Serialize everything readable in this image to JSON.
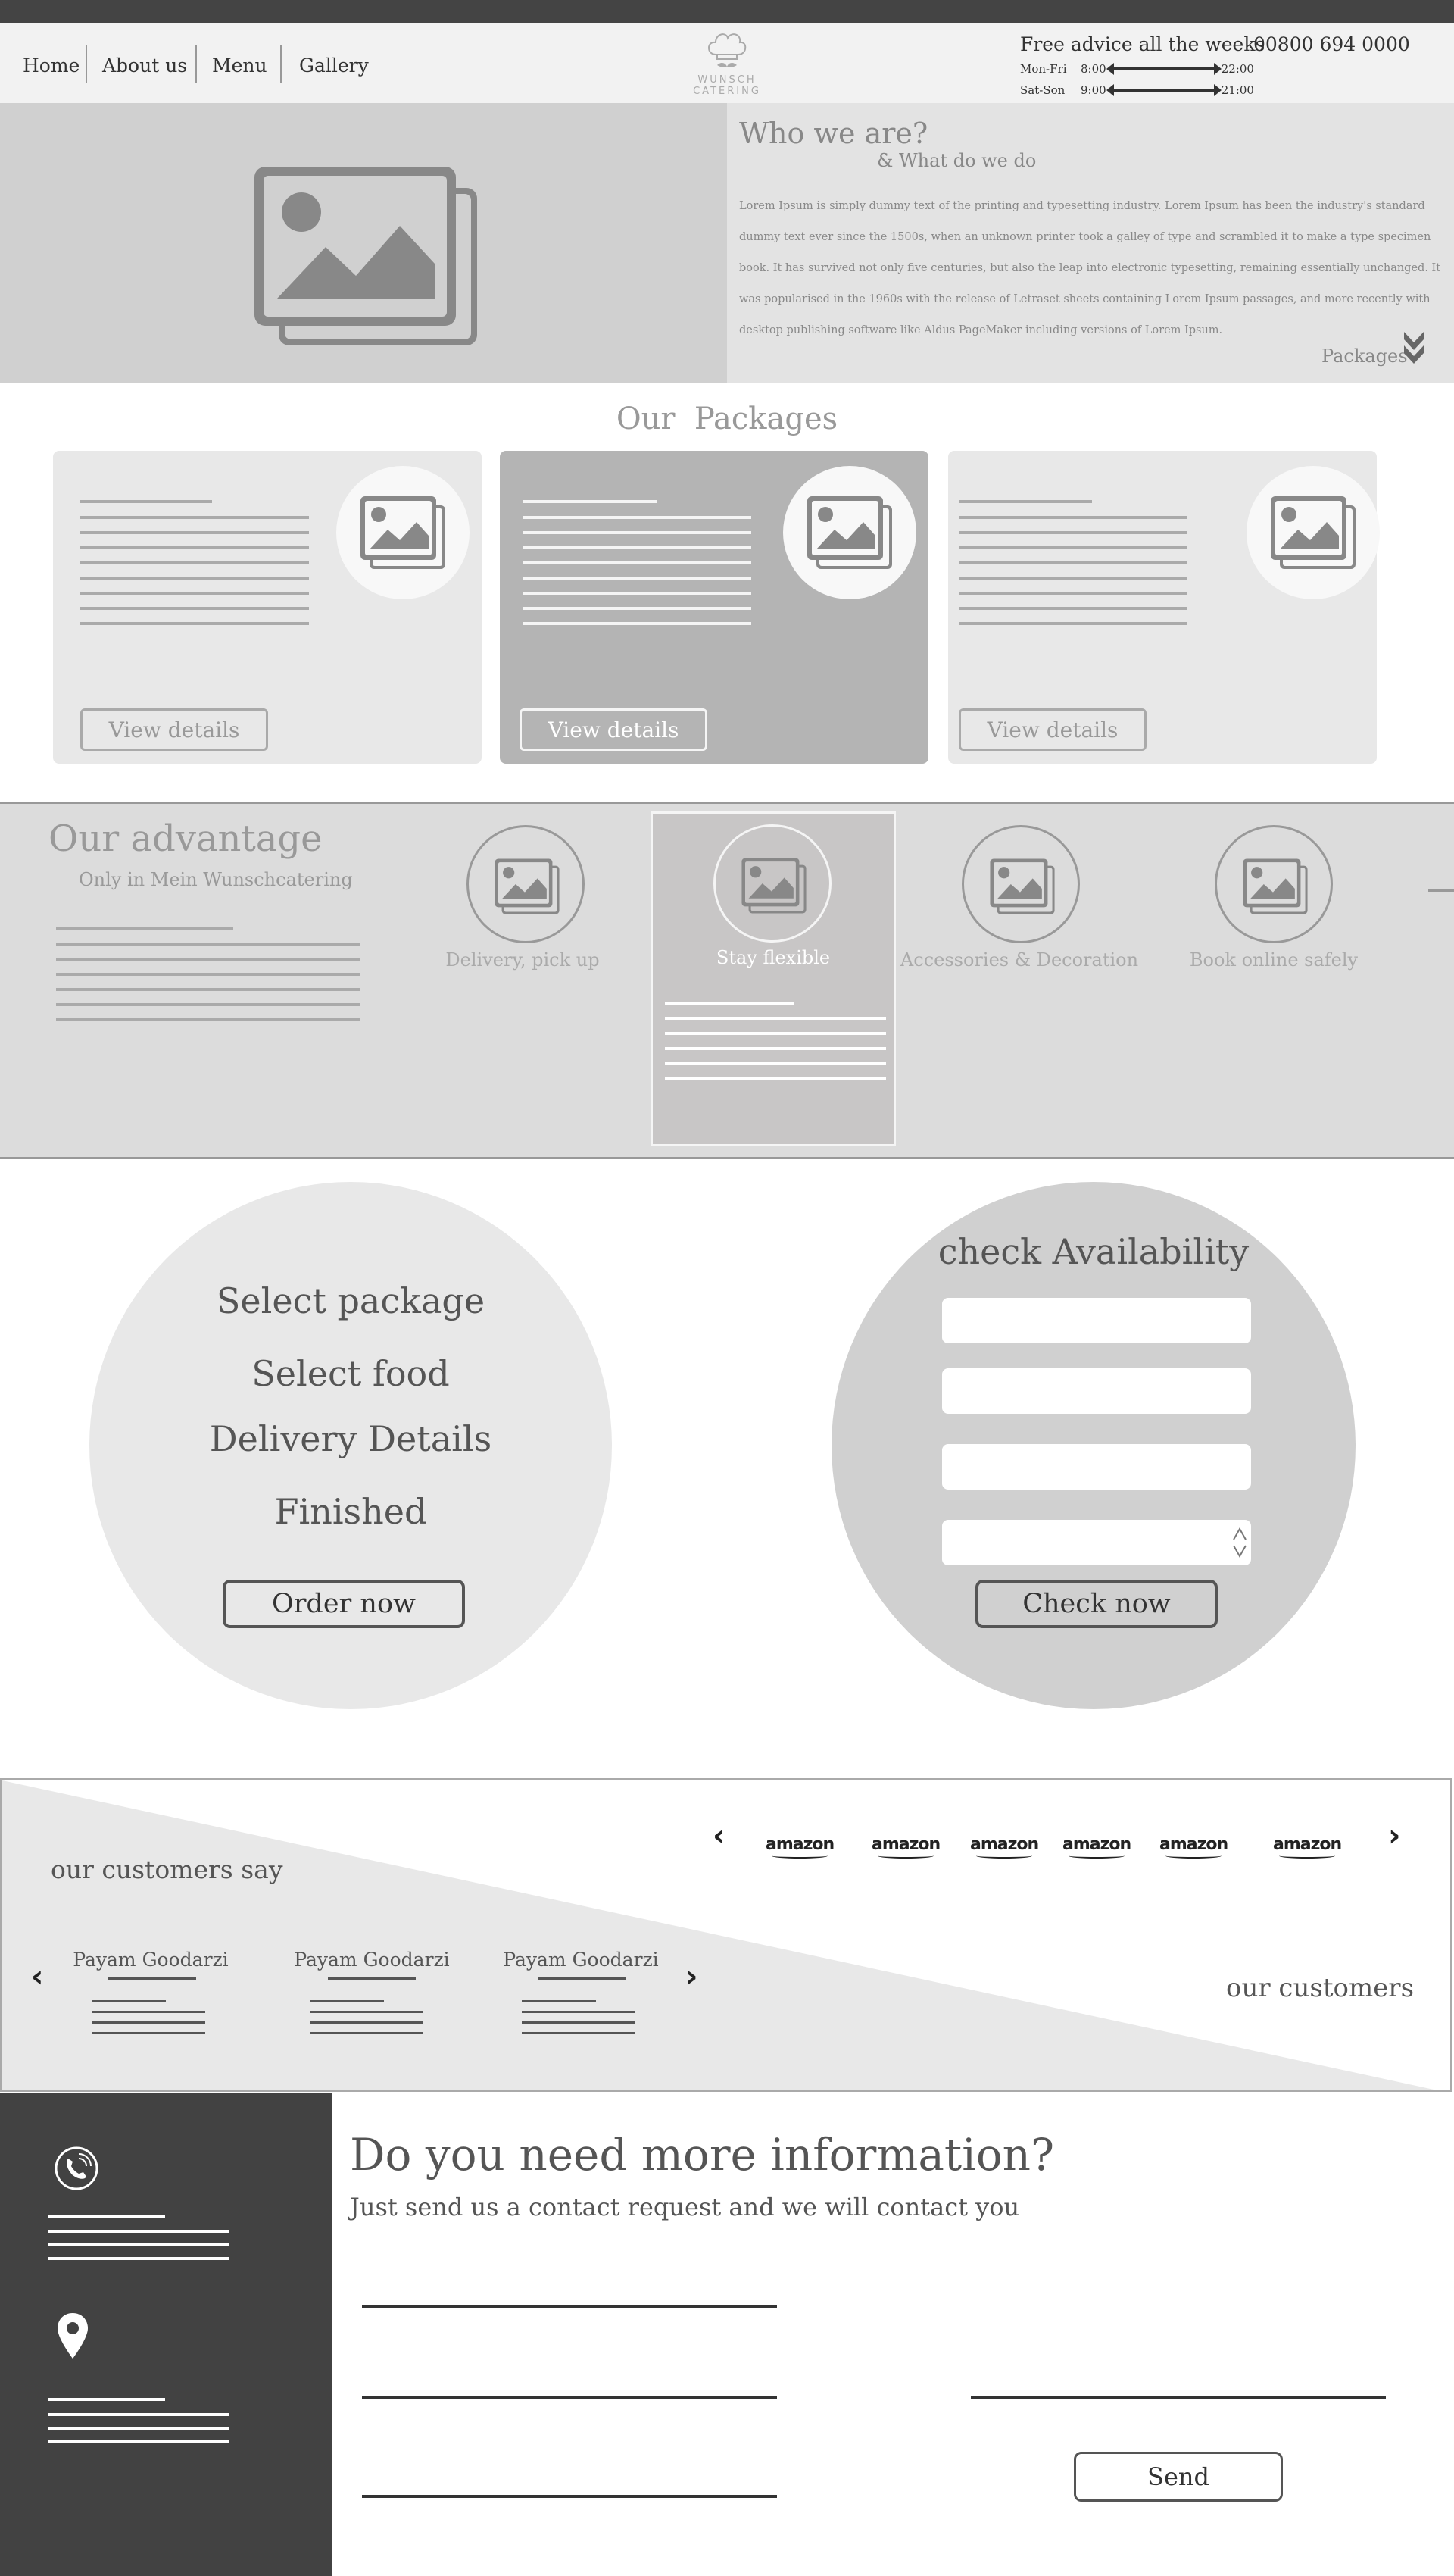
{
  "nav": {
    "home": "Home",
    "about": "About us",
    "menu": "Menu",
    "gallery": "Gallery"
  },
  "logo": {
    "name_line1": "WUNSCH",
    "name_line2": "CATERING"
  },
  "contact": {
    "advice": "Free advice all the weeks",
    "phone": "00800 694 0000",
    "weekday_label": "Mon-Fri",
    "weekday_open": "8:00",
    "weekday_close": "22:00",
    "weekend_label": "Sat-Son",
    "weekend_open": "9:00",
    "weekend_close": "21:00"
  },
  "about": {
    "title": "Who we are?",
    "subtitle": "& What do we do",
    "body": "Lorem Ipsum is simply dummy text of the printing and typesetting industry. Lorem Ipsum has been the industry's standard dummy text ever since the 1500s, when an unknown printer took a galley of type and scrambled it to make a type specimen book. It has survived not only five centuries, but also the leap into electronic typesetting, remaining essentially unchanged. It was popularised in the 1960s with the release of Letraset sheets containing Lorem Ipsum passages, and more recently with desktop publishing software like Aldus PageMaker including versions of Lorem Ipsum.",
    "packages_link": "Packages"
  },
  "packages": {
    "title": "Our  Packages",
    "cards": [
      {
        "button": "View details"
      },
      {
        "button": "View details"
      },
      {
        "button": "View details"
      }
    ]
  },
  "advantage": {
    "title": "Our advantage",
    "subtitle": "Only in Mein Wunschcatering",
    "items": [
      {
        "label": "Delivery, pick up"
      },
      {
        "label": "Stay flexible"
      },
      {
        "label": "Accessories & Decoration"
      },
      {
        "label": "Book online safely"
      }
    ]
  },
  "order": {
    "steps": [
      "Select package",
      "Select food",
      "Delivery Details",
      "Finished"
    ],
    "button": "Order now"
  },
  "availability": {
    "title": "check Availability",
    "button": "Check now"
  },
  "customers": {
    "say_title": "our customers say",
    "logos_title": "our customers",
    "reviewers": [
      "Payam Goodarzi",
      "Payam Goodarzi",
      "Payam Goodarzi"
    ],
    "logos": [
      "amazon",
      "amazon",
      "amazon",
      "amazon",
      "amazon",
      "amazon"
    ]
  },
  "footer": {
    "title": "Do you need more information?",
    "subtitle": "Just send us a contact request and we will contact you",
    "send": "Send"
  },
  "colors": {
    "dark": "#424242",
    "light": "#e8e8e8",
    "mid": "#b4b4b4",
    "accent": "#555555"
  }
}
